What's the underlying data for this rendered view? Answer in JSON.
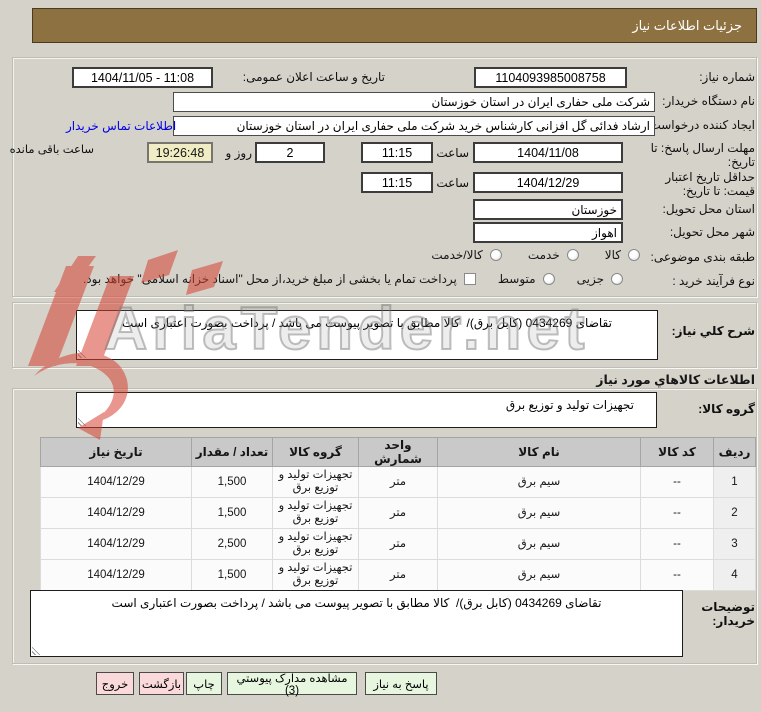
{
  "title": "جزئیات اطلاعات نیاز",
  "fields": {
    "need_number": {
      "label": "شماره نیاز:",
      "value": "1104093985008758"
    },
    "announce": {
      "label": "تاریخ و ساعت اعلان عمومی:",
      "value": "1404/11/05 - 11:08"
    },
    "buyer_name": {
      "label": "نام دستگاه خریدار:",
      "value": "شرکت ملی حفاری ایران در استان خوزستان"
    },
    "requester": {
      "label": "ایجاد کننده درخواست:",
      "value": "ارشاد فدائی گل افزانی کارشناس خرید شرکت ملی حفاری ایران در استان خوزستان",
      "link": "اطلاعات تماس خریدار"
    },
    "deadline": {
      "label": "مهلت ارسال پاسخ: تا تاریخ:",
      "date": "1404/11/08",
      "hour_label": "ساعت",
      "time": "11:15",
      "days_value": "2",
      "days_label": "روز و",
      "countdown": "19:26:48",
      "remaining_label": "ساعت باقی مانده"
    },
    "validity": {
      "label": "حداقل تاریخ اعتبار قیمت: تا تاریخ:",
      "date": "1404/12/29",
      "hour_label": "ساعت",
      "time": "11:15"
    },
    "province": {
      "label": "استان محل تحویل:",
      "value": "خوزستان"
    },
    "city": {
      "label": "شهر محل تحویل:",
      "value": "اهواز"
    },
    "category": {
      "label": "طبقه بندی موضوعی:",
      "options": [
        "کالا",
        "خدمت",
        "کالا/خدمت"
      ]
    },
    "process": {
      "label": "نوع فرآیند خرید :",
      "options": [
        "جزيی",
        "متوسط"
      ],
      "checkbox_label": "پرداخت تمام یا بخشی از مبلغ خرید،از محل \"اسناد خزانه اسلامی\" خواهد بود."
    },
    "description": {
      "label": "شرح کلي نیاز:",
      "value": "تقاضای 0434269 (کابل برق)/  کالا مطابق با تصویر پیوست می باشد / پرداخت بصورت اعتباری است"
    },
    "goods_group": {
      "label": "گروه کالا:",
      "value": "تجهیزات تولید و توزیع برق"
    },
    "buyer_notes": {
      "label": "توضیحات خریدار:",
      "value": "تقاضای 0434269 (کابل برق)/  کالا مطابق با تصویر پیوست می باشد / پرداخت بصورت اعتباری است"
    }
  },
  "section_header": "اطلاعات کالاهاي مورد نیاز",
  "table": {
    "headers": [
      "ردیف",
      "کد کالا",
      "نام کالا",
      "واحد شمارش",
      "گروه کالا",
      "تعداد / مقدار",
      "تاریخ نیاز"
    ],
    "rows": [
      [
        "1",
        "--",
        "سیم برق",
        "متر",
        "تجهیزات تولید و توزیع برق",
        "1,500",
        "1404/12/29"
      ],
      [
        "2",
        "--",
        "سیم برق",
        "متر",
        "تجهیزات تولید و توزیع برق",
        "1,500",
        "1404/12/29"
      ],
      [
        "3",
        "--",
        "سیم برق",
        "متر",
        "تجهیزات تولید و توزیع برق",
        "2,500",
        "1404/12/29"
      ],
      [
        "4",
        "--",
        "سیم برق",
        "متر",
        "تجهیزات تولید و توزیع برق",
        "1,500",
        "1404/12/29"
      ]
    ]
  },
  "buttons": [
    {
      "label": "پاسخ به نیاز"
    },
    {
      "label": "مشاهده مدارک پیوستي (3)"
    },
    {
      "label": "چاپ"
    },
    {
      "label": "بازگشت"
    },
    {
      "label": "خروج"
    }
  ],
  "watermark": {
    "text": "AriaTender.net"
  },
  "colors": {
    "titlebar": "#8e7140",
    "countdown_bg": "#f0ecc4",
    "button_green": "#e7f6df",
    "button_pink": "#f9d9da",
    "link_blue": "#0000e8",
    "watermark_red": "#d64233"
  }
}
